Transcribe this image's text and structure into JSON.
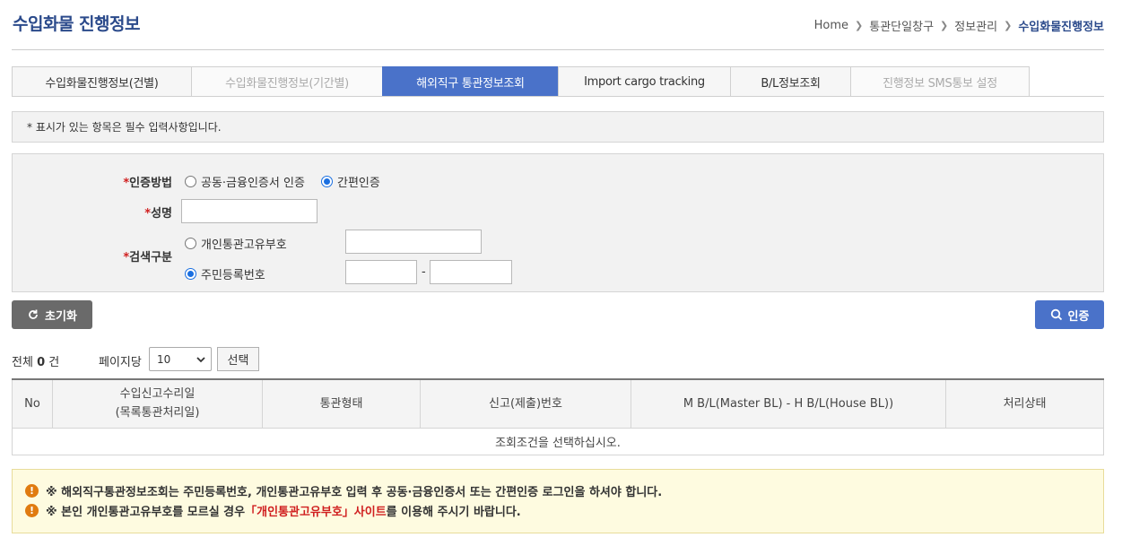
{
  "page": {
    "title": "수입화물 진행정보"
  },
  "breadcrumb": [
    "Home",
    "통관단일창구",
    "정보관리",
    "수입화물진행정보"
  ],
  "tabs": [
    {
      "label": "수입화물진행정보(건별)",
      "state": "normal"
    },
    {
      "label": "수입화물진행정보(기간별)",
      "state": "disabled"
    },
    {
      "label": "해외직구 통관정보조회",
      "state": "active"
    },
    {
      "label": "Import cargo tracking",
      "state": "normal"
    },
    {
      "label": "B/L정보조회",
      "state": "normal"
    },
    {
      "label": "진행정보 SMS통보 설정",
      "state": "disabled"
    }
  ],
  "notice": "* 표시가 있는 항목은 필수 입력사항입니다.",
  "form": {
    "required_mark": "*",
    "auth_method": {
      "label": "인증방법",
      "options": [
        {
          "label": "공동·금융인증서 인증",
          "checked": false
        },
        {
          "label": "간편인증",
          "checked": true
        }
      ]
    },
    "name": {
      "label": "성명",
      "value": ""
    },
    "search_type": {
      "label": "검색구분",
      "options": [
        {
          "label": "개인통관고유부호",
          "checked": false,
          "value": ""
        },
        {
          "label": "주민등록번호",
          "checked": true,
          "value1": "",
          "value2": ""
        }
      ],
      "dash": "-"
    }
  },
  "buttons": {
    "reset": "초기화",
    "auth": "인증",
    "select": "선택"
  },
  "list": {
    "total_prefix": "전체",
    "total_count": "0",
    "total_suffix": "건",
    "per_page_label": "페이지당",
    "per_page_value": "10"
  },
  "table": {
    "headers": [
      {
        "line1": "No",
        "line2": ""
      },
      {
        "line1": "수입신고수리일",
        "line2": "(목록통관처리일)"
      },
      {
        "line1": "통관형태",
        "line2": ""
      },
      {
        "line1": "신고(제출)번호",
        "line2": ""
      },
      {
        "line1": "M B/L(Master BL) - H B/L(House BL))",
        "line2": ""
      },
      {
        "line1": "처리상태",
        "line2": ""
      }
    ],
    "empty_message": "조회조건을 선택하십시오."
  },
  "alerts": {
    "line1": "※ 해외직구통관정보조회는 주민등록번호, 개인통관고유부호 입력 후 공동·금융인증서 또는 간편인증 로그인을 하셔야 합니다.",
    "line2_pre": "※ 본인 개인통관고유부호를 모르실 경우 ",
    "line2_link": "「개인통관고유부호」사이트",
    "line2_post": "를 이용해 주시기 바랍니다."
  },
  "colors": {
    "accent": "#4a72c9",
    "title": "#2b4a8b",
    "required": "#d02020",
    "alert_bg": "#fefbe0",
    "alert_icon": "#e07b10"
  }
}
